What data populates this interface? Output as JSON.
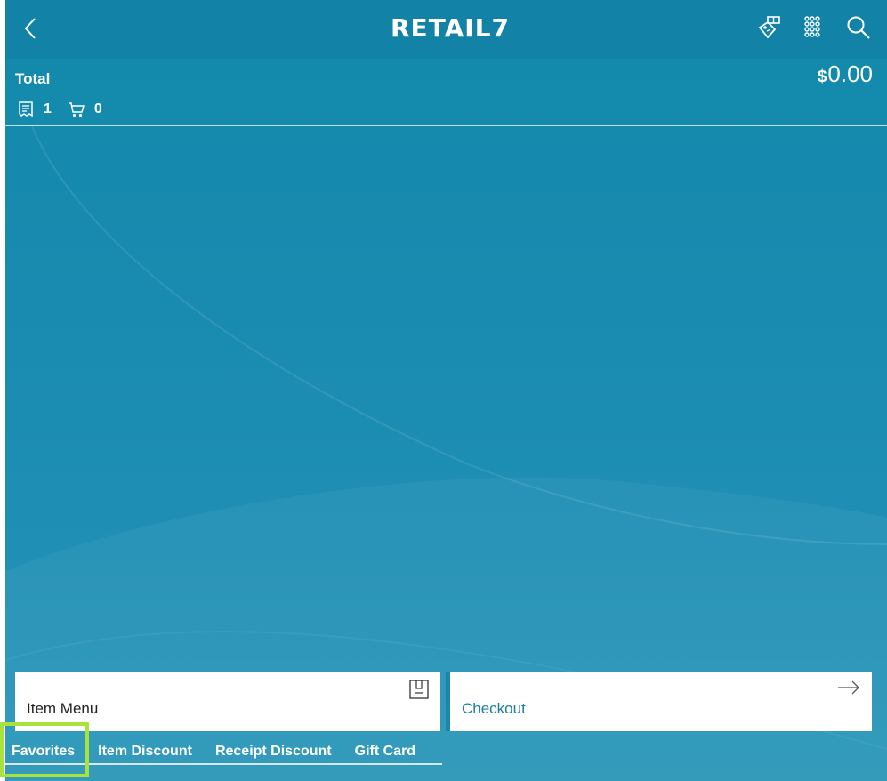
{
  "app": {
    "logo_text": "RETAIL7"
  },
  "header": {
    "total_label": "Total",
    "currency_symbol": "$",
    "total_amount": "0.00",
    "receipt_count": "1",
    "cart_count": "0"
  },
  "panels": {
    "item_menu_label": "Item Menu",
    "checkout_label": "Checkout"
  },
  "tabs": [
    {
      "label": "Favorites"
    },
    {
      "label": "Item Discount"
    },
    {
      "label": "Receipt Discount"
    },
    {
      "label": "Gift Card"
    }
  ],
  "colors": {
    "header": "#1283a6",
    "background": "#1a8bb0",
    "highlight": "#a8e23a",
    "checkout_text": "#1a7fa5"
  },
  "icons": [
    "back-icon",
    "price-tag-icon",
    "keypad-icon",
    "search-icon",
    "receipt-icon",
    "cart-icon",
    "item-menu-icon",
    "arrow-right-icon"
  ]
}
